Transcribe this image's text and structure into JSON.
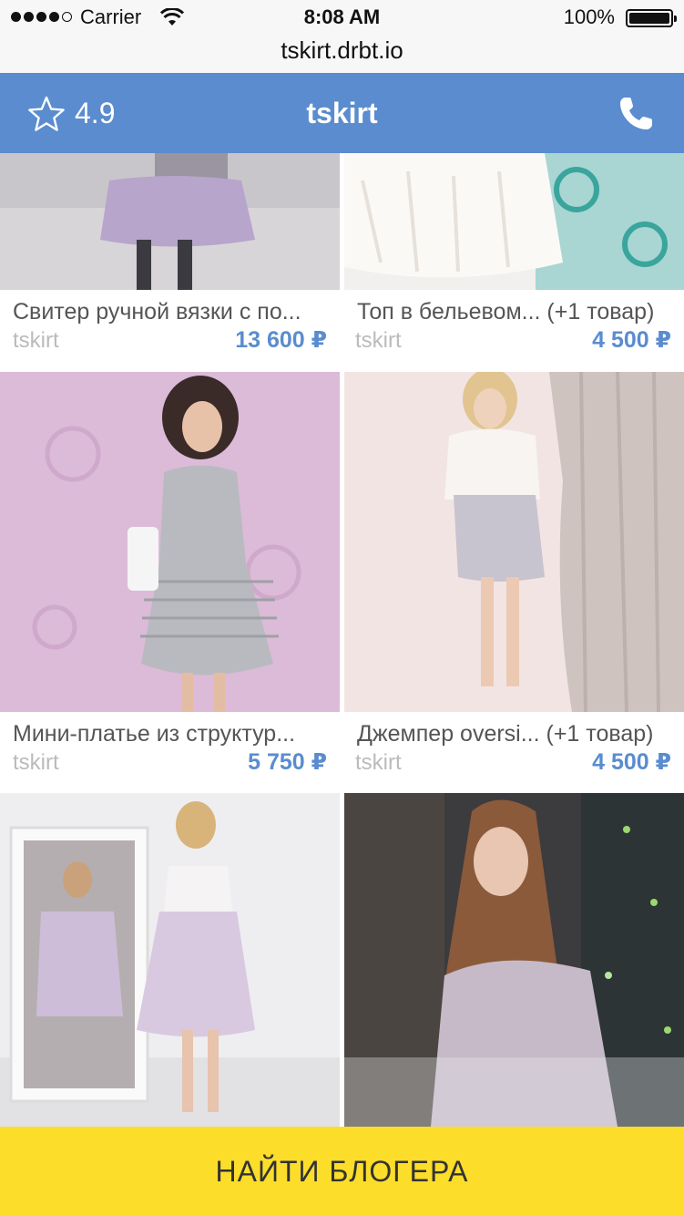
{
  "status_bar": {
    "carrier": "Carrier",
    "time": "8:08 AM",
    "battery": "100%",
    "battery_level": 1.0
  },
  "browser": {
    "url": "tskirt.drbt.io"
  },
  "header": {
    "rating": "4.9",
    "title": "tskirt",
    "star_icon": "star-outline-icon",
    "phone_icon": "phone-icon",
    "color": "#5a8ccf"
  },
  "products": [
    {
      "name": "Свитер ручной вязки с по...",
      "seller": "tskirt",
      "price": "13 600 ₽"
    },
    {
      "name": "Топ в бельевом... (+1 товар)",
      "seller": "tskirt",
      "price": "4 500 ₽"
    },
    {
      "name": "Мини-платье из структур...",
      "seller": "tskirt",
      "price": "5 750 ₽"
    },
    {
      "name": "Джемпер oversi... (+1 товар)",
      "seller": "tskirt",
      "price": "4 500 ₽"
    },
    {
      "name": "",
      "seller": "",
      "price": ""
    },
    {
      "name": "",
      "seller": "",
      "price": ""
    }
  ],
  "cta": {
    "label": "НАЙТИ БЛОГЕРА",
    "color": "#fcdd2a"
  }
}
